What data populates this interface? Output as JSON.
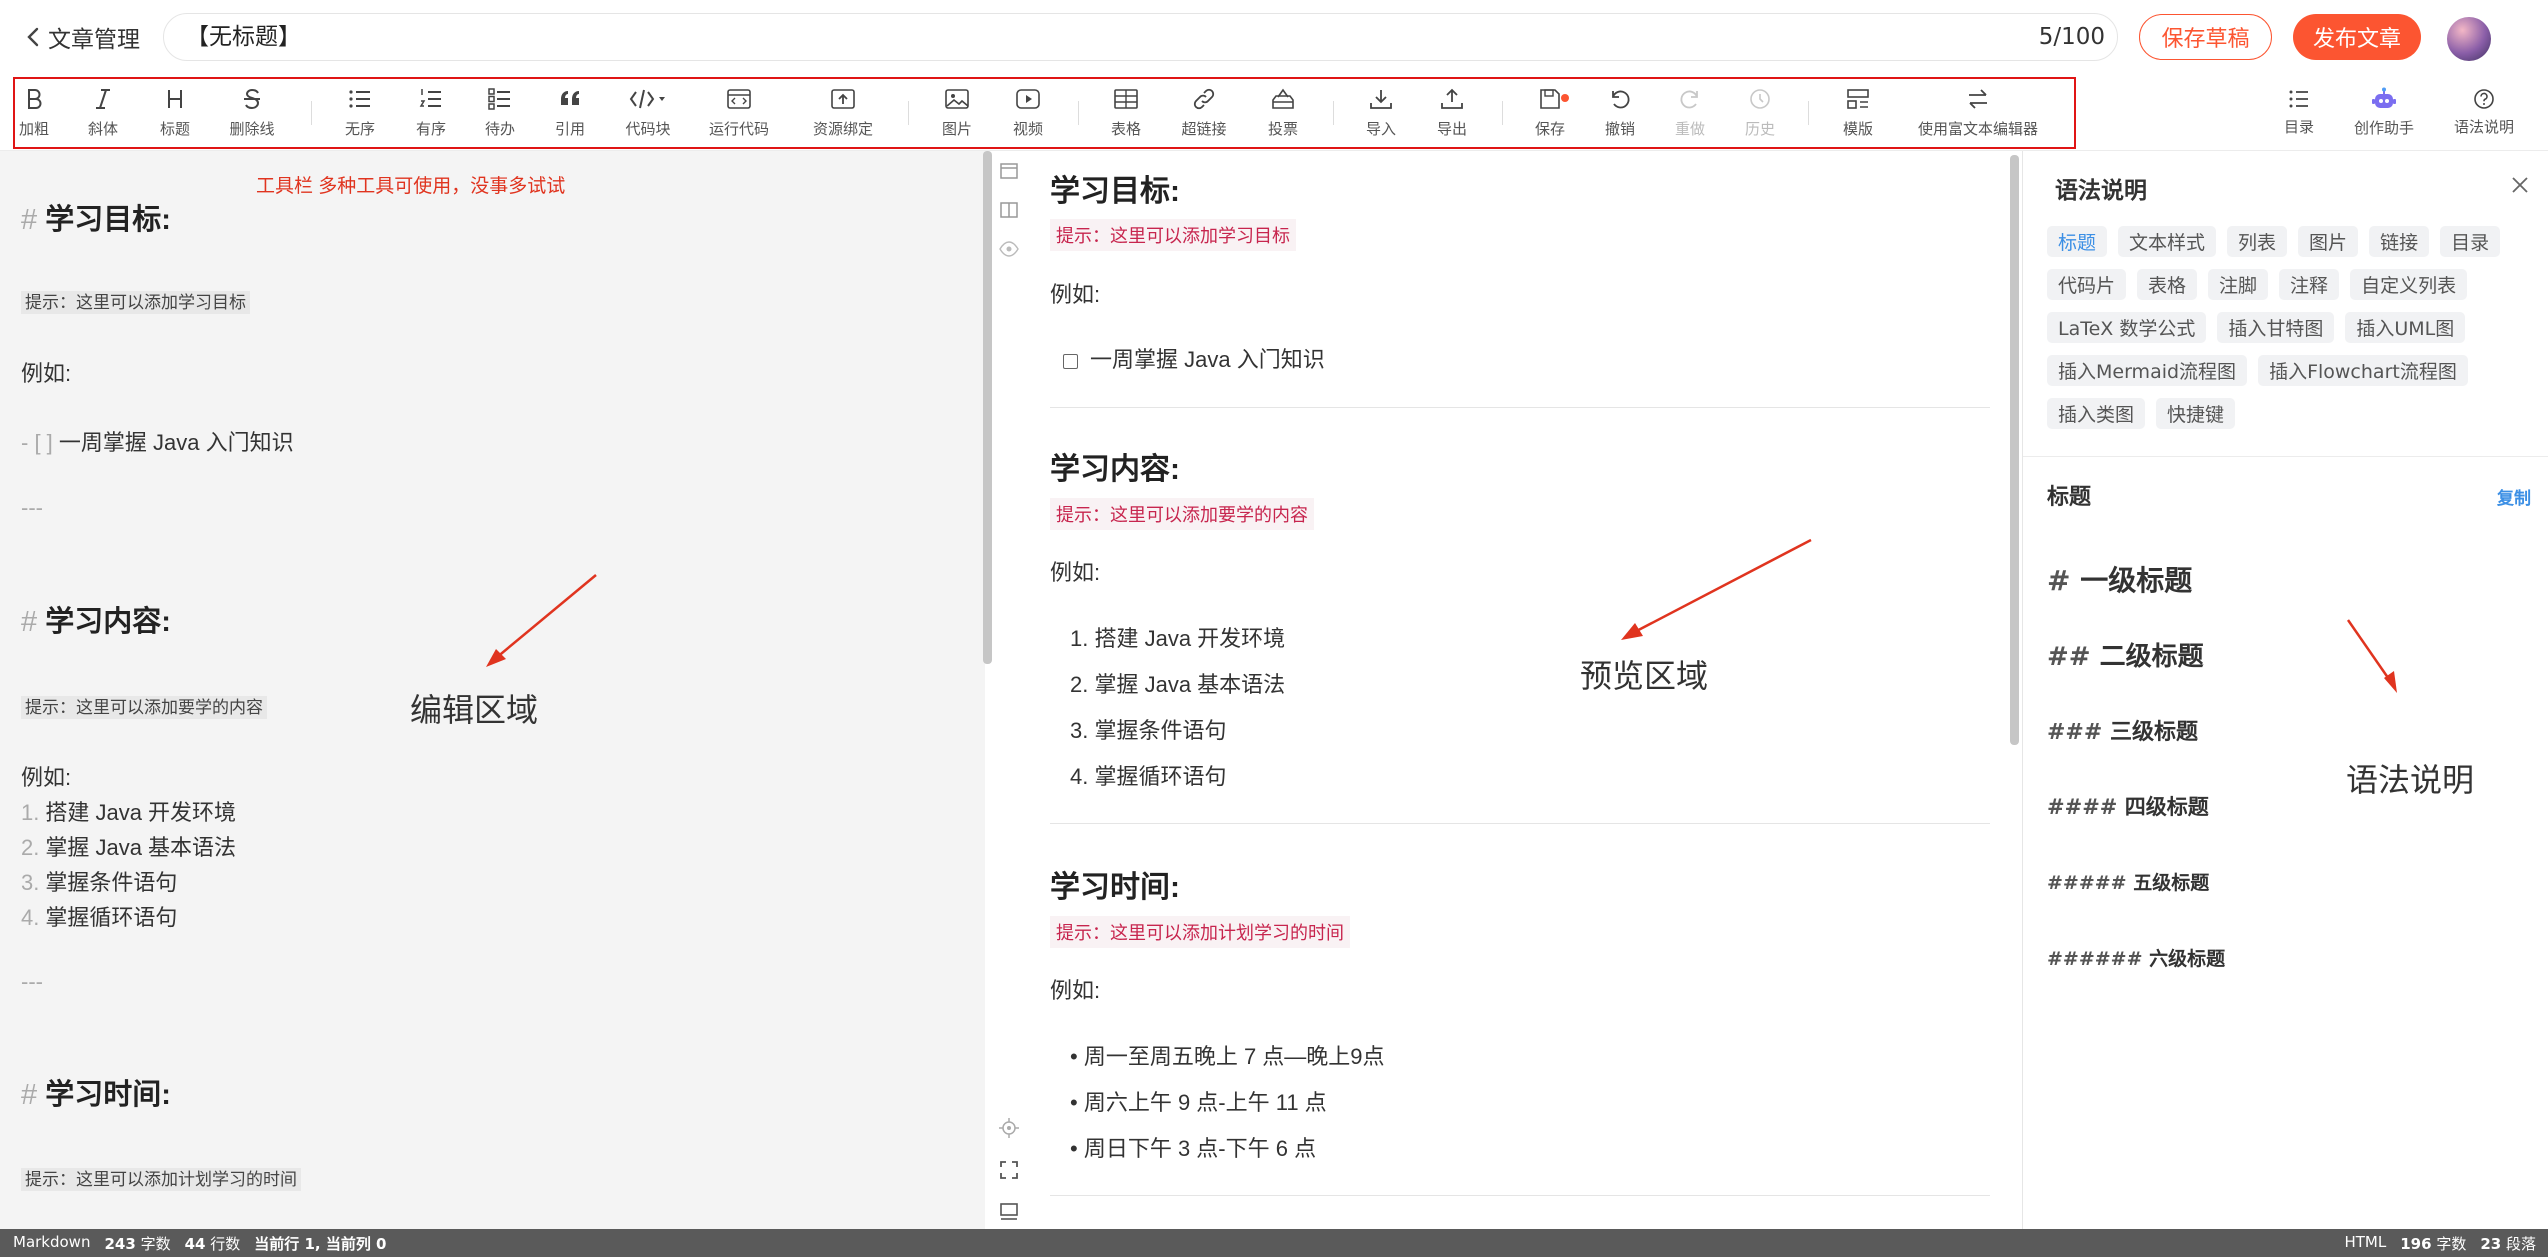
{
  "header": {
    "back_label": "文章管理",
    "title_value": "【无标题】",
    "title_count": "5/100",
    "save_draft": "保存草稿",
    "publish": "发布文章"
  },
  "toolbar": [
    {
      "label": "加粗",
      "icon": "bold-icon"
    },
    {
      "label": "斜体",
      "icon": "italic-icon"
    },
    {
      "label": "标题",
      "icon": "heading-icon"
    },
    {
      "label": "删除线",
      "icon": "strikethrough-icon"
    },
    {
      "label": "无序",
      "icon": "unordered-list-icon"
    },
    {
      "label": "有序",
      "icon": "ordered-list-icon"
    },
    {
      "label": "待办",
      "icon": "todo-list-icon"
    },
    {
      "label": "引用",
      "icon": "quote-icon"
    },
    {
      "label": "代码块",
      "icon": "code-block-icon"
    },
    {
      "label": "运行代码",
      "icon": "run-code-icon"
    },
    {
      "label": "资源绑定",
      "icon": "resource-bind-icon"
    },
    {
      "label": "图片",
      "icon": "image-icon"
    },
    {
      "label": "视频",
      "icon": "video-icon"
    },
    {
      "label": "表格",
      "icon": "table-icon"
    },
    {
      "label": "超链接",
      "icon": "link-icon"
    },
    {
      "label": "投票",
      "icon": "vote-icon"
    },
    {
      "label": "导入",
      "icon": "import-icon"
    },
    {
      "label": "导出",
      "icon": "export-icon"
    },
    {
      "label": "保存",
      "icon": "save-icon"
    },
    {
      "label": "撤销",
      "icon": "undo-icon"
    },
    {
      "label": "重做",
      "icon": "redo-icon"
    },
    {
      "label": "历史",
      "icon": "history-icon"
    },
    {
      "label": "模版",
      "icon": "template-icon"
    },
    {
      "label": "使用富文本编辑器",
      "icon": "rich-text-switch-icon"
    }
  ],
  "right_nav": [
    {
      "label": "目录",
      "icon": "toc-icon"
    },
    {
      "label": "创作助手",
      "icon": "robot-icon"
    },
    {
      "label": "语法说明",
      "icon": "help-icon"
    }
  ],
  "annotations": {
    "toolbar_note": "工具栏 多种工具可使用，没事多试试",
    "editor": "编辑区域",
    "preview": "预览区域",
    "syntax": "语法说明"
  },
  "editor": {
    "h1": "学习目标:",
    "tip1": "提示：这里可以添加学习目标",
    "example1": "例如:",
    "todo1": "一周掌握 Java 入门知识",
    "hr1": "---",
    "h2": "学习内容:",
    "tip2": "提示：这里可以添加要学的内容",
    "example2": "例如:",
    "list": [
      "搭建 Java 开发环境",
      "掌握 Java 基本语法",
      "掌握条件语句",
      "掌握循环语句"
    ],
    "hr2": "---",
    "h3": "学习时间:",
    "tip3": "提示：这里可以添加计划学习的时间"
  },
  "preview": {
    "h1": "学习目标:",
    "tip1": "提示：这里可以添加学习目标",
    "example1": "例如:",
    "todo1": "一周掌握 Java 入门知识",
    "h2": "学习内容:",
    "tip2": "提示：这里可以添加要学的内容",
    "example2": "例如:",
    "list": [
      "搭建 Java 开发环境",
      "掌握 Java 基本语法",
      "掌握条件语句",
      "掌握循环语句"
    ],
    "h3": "学习时间:",
    "tip3": "提示：这里可以添加计划学习的时间",
    "example3": "例如:",
    "times": [
      "周一至周五晚上 7 点—晚上9点",
      "周六上午 9 点-上午 11 点",
      "周日下午 3 点-下午 6 点"
    ]
  },
  "syntax_panel": {
    "title": "语法说明",
    "tags": [
      "标题",
      "文本样式",
      "列表",
      "图片",
      "链接",
      "目录",
      "代码片",
      "表格",
      "注脚",
      "注释",
      "自定义列表",
      "LaTeX 数学公式",
      "插入甘特图",
      "插入UML图",
      "插入Mermaid流程图",
      "插入Flowchart流程图",
      "插入类图",
      "快捷键"
    ],
    "section_title": "标题",
    "copy": "复制",
    "headings": [
      {
        "hash": "#",
        "text": "一级标题"
      },
      {
        "hash": "##",
        "text": "二级标题"
      },
      {
        "hash": "###",
        "text": "三级标题"
      },
      {
        "hash": "####",
        "text": "四级标题"
      },
      {
        "hash": "#####",
        "text": "五级标题"
      },
      {
        "hash": "######",
        "text": "六级标题"
      }
    ]
  },
  "status": {
    "mode": "Markdown",
    "words": "243",
    "words_unit": "字数",
    "lines": "44",
    "lines_unit": "行数",
    "cursor": "当前行 1, 当前列 0",
    "right_mode": "HTML",
    "right_words": "196",
    "right_words_unit": "字数",
    "paragraphs": "23",
    "paragraphs_unit": "段落"
  },
  "colors": {
    "accent": "#fc5531",
    "annotation_red": "#e01515",
    "tag_blue": "#3b8fe5",
    "tip_pink": "#c7254e",
    "status_bar": "#5a5a5a"
  }
}
